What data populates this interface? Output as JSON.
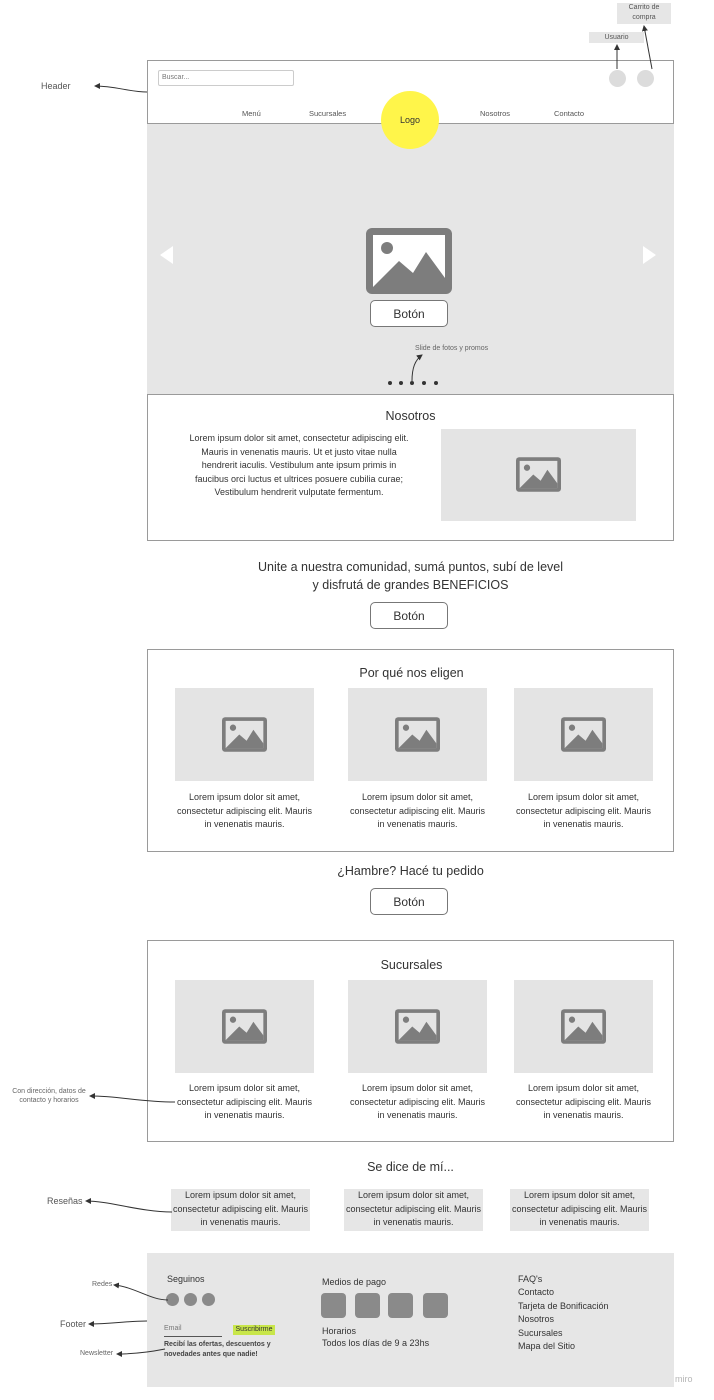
{
  "annotations": {
    "cart": "Carrito de compra",
    "user": "Usuario",
    "header": "Header",
    "slide": "Slide de fotos y promos",
    "branches_note": "Con dirección, datos de contacto y horarios",
    "reviews": "Reseñas",
    "socials": "Redes",
    "footer": "Footer",
    "newsletter": "Newsletter"
  },
  "header": {
    "search_placeholder": "Buscar...",
    "logo": "Logo",
    "nav": [
      "Menú",
      "Sucursales",
      "Nosotros",
      "Contacto"
    ]
  },
  "hero": {
    "button": "Botón"
  },
  "about": {
    "title": "Nosotros",
    "text": "Lorem ipsum dolor sit amet, consectetur adipiscing elit. Mauris in venenatis mauris. Ut et justo vitae nulla hendrerit iaculis. Vestibulum ante ipsum primis in faucibus orci luctus et ultrices posuere cubilia curae; Vestibulum hendrerit vulputate fermentum."
  },
  "community": {
    "line1": "Unite a nuestra comunidad, sumá puntos, subí de level",
    "line2": "y disfrutá de grandes BENEFICIOS",
    "button": "Botón"
  },
  "why": {
    "title": "Por qué nos eligen",
    "cards": [
      "Lorem ipsum dolor sit amet, consectetur adipiscing elit. Mauris in venenatis mauris.",
      "Lorem ipsum dolor sit amet, consectetur adipiscing elit. Mauris in venenatis mauris.",
      "Lorem ipsum dolor sit amet, consectetur adipiscing elit. Mauris in venenatis mauris."
    ]
  },
  "order": {
    "title": "¿Hambre? Hacé tu pedido",
    "button": "Botón"
  },
  "branches": {
    "title": "Sucursales",
    "cards": [
      "Lorem ipsum dolor sit amet, consectetur adipiscing elit. Mauris in venenatis mauris.",
      "Lorem ipsum dolor sit amet, consectetur adipiscing elit. Mauris in venenatis mauris.",
      "Lorem ipsum dolor sit amet, consectetur adipiscing elit. Mauris in venenatis mauris."
    ]
  },
  "reviews": {
    "title": "Se dice de mí...",
    "items": [
      "Lorem ipsum dolor sit amet, consectetur adipiscing elit. Mauris in venenatis mauris.",
      "Lorem ipsum dolor sit amet, consectetur adipiscing elit. Mauris in venenatis mauris.",
      "Lorem ipsum dolor sit amet, consectetur adipiscing elit. Mauris in venenatis mauris."
    ]
  },
  "footer": {
    "follow": "Seguinos",
    "email_placeholder": "Email",
    "subscribe": "Suscribirme",
    "newsletter_text": "Recibí las ofertas, descuentos y novedades antes que nadie!",
    "payments": "Medios de pago",
    "hours_title": "Horarios",
    "hours": "Todos los días de 9 a 23hs",
    "links": [
      "FAQ's",
      "Contacto",
      "Tarjeta de Bonificación",
      "Nosotros",
      "Sucursales",
      "Mapa del Sitio"
    ]
  },
  "watermark": "miro",
  "colors": {
    "logo": "#fff54a",
    "subscribe": "#c8e64a",
    "panel": "#e6e6e6",
    "icon": "#7d7d7d"
  }
}
